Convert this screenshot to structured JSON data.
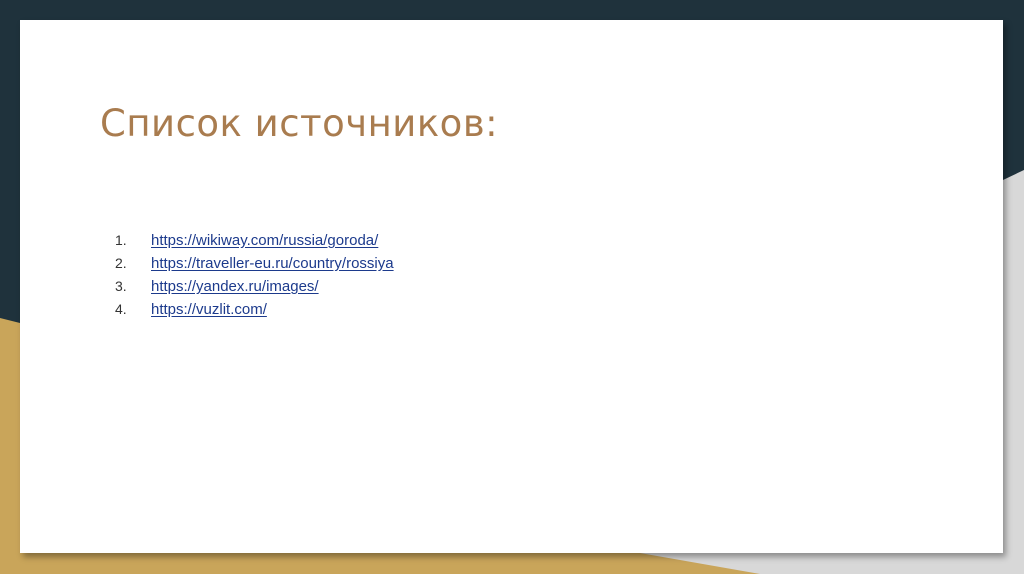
{
  "slide": {
    "title": "Список источников:",
    "sources": [
      {
        "number": "1.",
        "url": "https://wikiway.com/russia/goroda/"
      },
      {
        "number": "2.",
        "url": "https://traveller-eu.ru/country/rossiya"
      },
      {
        "number": "3.",
        "url": "https://yandex.ru/images/"
      },
      {
        "number": "4.",
        "url": "https://vuzlit.com/"
      }
    ]
  },
  "colors": {
    "background_dark": "#1f323c",
    "accent_gold": "#c9a55a",
    "title": "#a97c4f",
    "link": "#1c3a8c"
  }
}
